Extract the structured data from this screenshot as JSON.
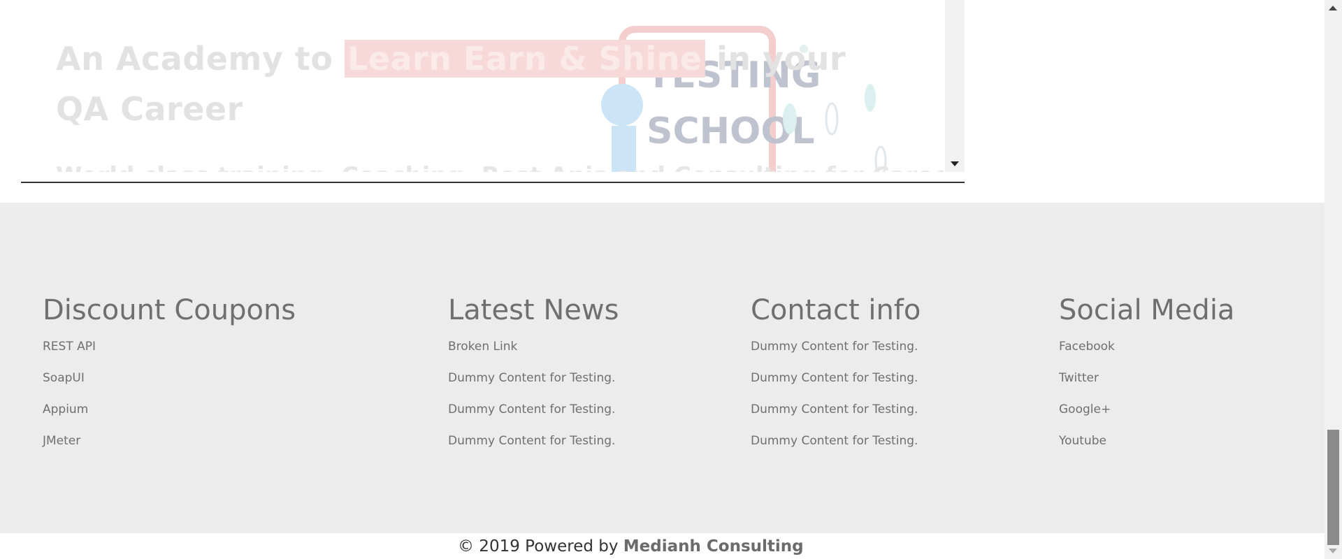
{
  "hero": {
    "heading_prefix": "An Academy to ",
    "heading_highlight": "Learn Earn & Shine",
    "heading_suffix": "  in your QA Career",
    "subtitle_partial": "World class training, Coaching, Rest Apis and Consulting for Career..."
  },
  "footer": {
    "columns": [
      {
        "title": "Discount Coupons",
        "links": [
          "REST API",
          "SoapUI",
          "Appium",
          "JMeter"
        ]
      },
      {
        "title": "Latest News",
        "links": [
          "Broken Link",
          "Dummy Content for Testing.",
          "Dummy Content for Testing.",
          "Dummy Content for Testing."
        ]
      },
      {
        "title": "Contact info",
        "links": [
          "Dummy Content for Testing.",
          "Dummy Content for Testing.",
          "Dummy Content for Testing.",
          "Dummy Content for Testing."
        ]
      },
      {
        "title": "Social Media",
        "links": [
          "Facebook",
          "Twitter",
          "Google+",
          "Youtube"
        ]
      }
    ],
    "copyright_prefix": "© 2019 Powered by ",
    "copyright_link": "Medianh Consulting"
  },
  "colors": {
    "footer_bg": "#ececec",
    "footer_text": "#6f6f6f",
    "hero_highlight_bg": "#f7d9d9"
  },
  "icons": {
    "hero_illustration": "testing-school-illustration",
    "iframe_scroll_down": "triangle-down-icon",
    "page_scroll_up": "triangle-up-icon",
    "page_scroll_down": "triangle-down-icon"
  }
}
